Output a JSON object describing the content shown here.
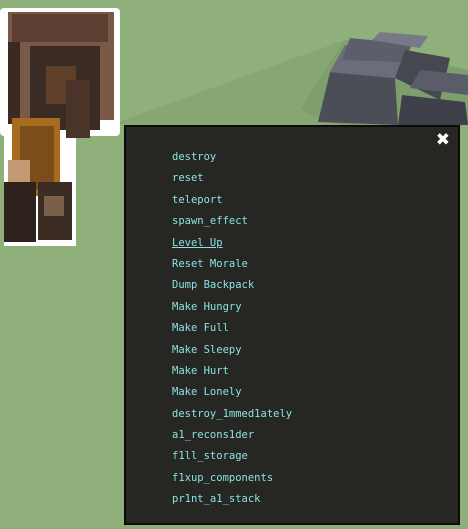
{
  "colors": {
    "grass": "#8fb07a",
    "panel_bg": "#262623",
    "command_text": "#8de1e6"
  },
  "scene": {
    "character": "voxel-worker-character",
    "structure": "voxel-stone-pile"
  },
  "debug_menu": {
    "close_icon": "✖",
    "commands": [
      {
        "label": "destroy"
      },
      {
        "label": "reset"
      },
      {
        "label": "teleport"
      },
      {
        "label": "spawn_effect"
      },
      {
        "label": "Level Up",
        "underlined": true
      },
      {
        "label": "Reset Morale"
      },
      {
        "label": "Dump Backpack"
      },
      {
        "label": "Make Hungry"
      },
      {
        "label": "Make Full"
      },
      {
        "label": "Make Sleepy"
      },
      {
        "label": "Make Hurt"
      },
      {
        "label": "Make Lonely"
      },
      {
        "label": "destroy_1mmed1ately"
      },
      {
        "label": "a1_recons1der"
      },
      {
        "label": "f1ll_storage"
      },
      {
        "label": "f1xup_components"
      },
      {
        "label": "pr1nt_a1_stack"
      }
    ]
  }
}
